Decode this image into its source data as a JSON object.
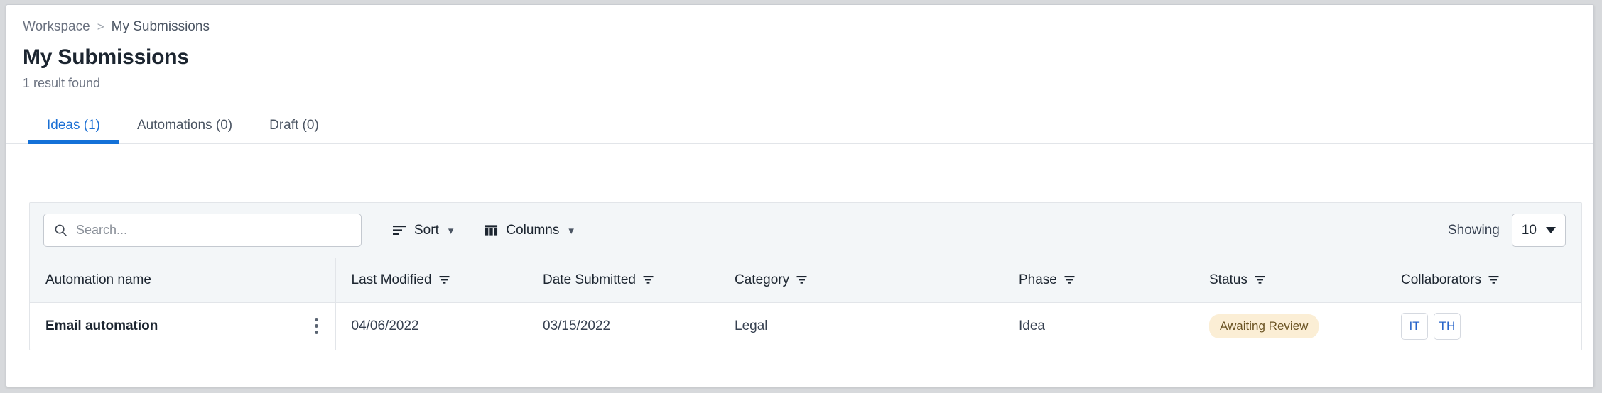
{
  "breadcrumb": {
    "root": "Workspace",
    "separator": ">",
    "current": "My Submissions"
  },
  "page": {
    "title": "My Submissions",
    "result_count": "1 result found"
  },
  "tabs": [
    {
      "label": "Ideas (1)",
      "active": true
    },
    {
      "label": "Automations (0)",
      "active": false
    },
    {
      "label": "Draft (0)",
      "active": false
    }
  ],
  "toolbar": {
    "search_placeholder": "Search...",
    "search_value": "",
    "search_icon": "search-icon",
    "sort_label": "Sort",
    "sort_icon": "sort-lines-icon",
    "columns_label": "Columns",
    "columns_icon": "columns-icon",
    "chevron_icon": "chevron-down-icon",
    "showing_label": "Showing",
    "showing_value": "10",
    "showing_options": [
      "10"
    ]
  },
  "table": {
    "columns": [
      {
        "label": "Automation name",
        "filterable": false
      },
      {
        "label": "Last Modified",
        "filterable": true
      },
      {
        "label": "Date Submitted",
        "filterable": true
      },
      {
        "label": "Category",
        "filterable": true
      },
      {
        "label": "Phase",
        "filterable": true
      },
      {
        "label": "Status",
        "filterable": true
      },
      {
        "label": "Collaborators",
        "filterable": true
      }
    ],
    "rows": [
      {
        "name": "Email automation",
        "last_modified": "04/06/2022",
        "date_submitted": "03/15/2022",
        "category": "Legal",
        "phase": "Idea",
        "status": "Awaiting Review",
        "collaborators": [
          "IT",
          "TH"
        ],
        "menu_icon": "kebab-menu-icon"
      }
    ]
  },
  "colors": {
    "accent": "#1471d8",
    "tab_active_text": "#1a6fd4",
    "badge_bg": "#fbeed5",
    "badge_text": "#6b5424",
    "avatar_text": "#2563c9",
    "toolbar_bg": "#f3f6f8",
    "border": "#e2e5e9"
  }
}
